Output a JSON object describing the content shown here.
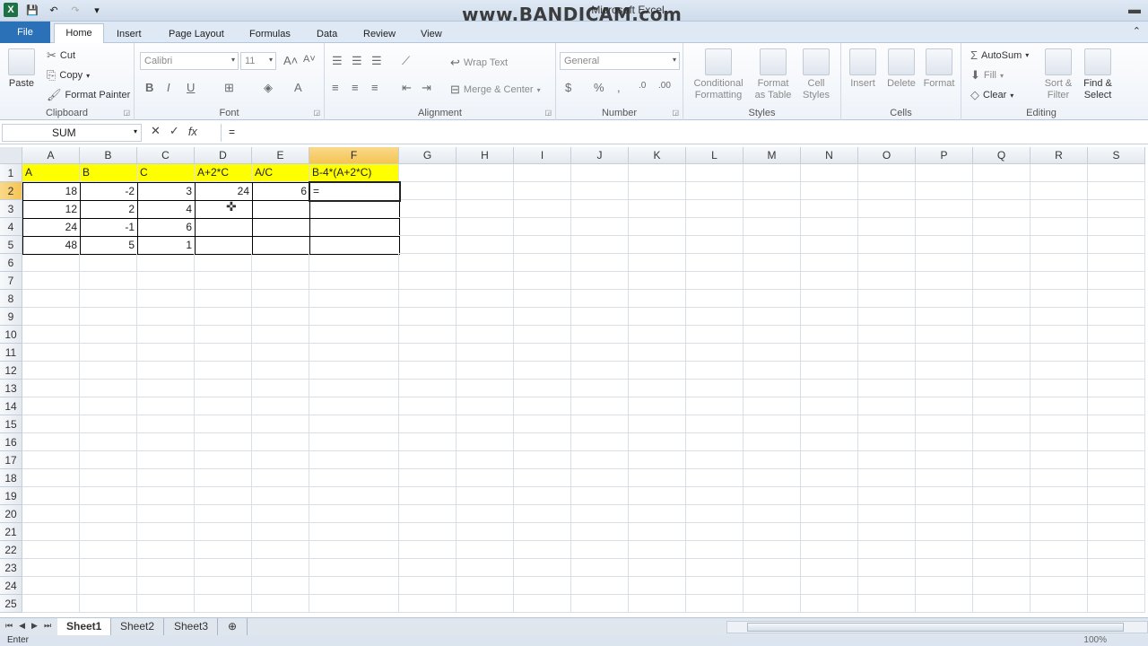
{
  "title_bar": {
    "window_title": "Microsoft Excel",
    "watermark": "www.BANDICAM.com"
  },
  "tabs": [
    "File",
    "Home",
    "Insert",
    "Page Layout",
    "Formulas",
    "Data",
    "Review",
    "View"
  ],
  "clipboard": {
    "paste": "Paste",
    "cut": "Cut",
    "copy": "Copy",
    "format_painter": "Format Painter",
    "label": "Clipboard"
  },
  "font": {
    "name": "Calibri",
    "size": "11",
    "label": "Font"
  },
  "alignment": {
    "wrap_text": "Wrap Text",
    "merge_center": "Merge & Center",
    "label": "Alignment"
  },
  "number": {
    "format": "General",
    "label": "Number"
  },
  "styles": {
    "conditional": "Conditional",
    "formatting": "Formatting",
    "format_as": "Format",
    "as_table": "as Table",
    "cell": "Cell",
    "styles_word": "Styles",
    "label": "Styles"
  },
  "cells": {
    "insert": "Insert",
    "delete": "Delete",
    "format": "Format",
    "label": "Cells"
  },
  "editing": {
    "autosum": "AutoSum",
    "fill": "Fill",
    "clear": "Clear",
    "sort": "Sort &",
    "filter": "Filter",
    "find": "Find &",
    "select": "Select",
    "label": "Editing"
  },
  "formula_bar": {
    "name_box": "SUM",
    "formula": "="
  },
  "columns": [
    "A",
    "B",
    "C",
    "D",
    "E",
    "F",
    "G",
    "H",
    "I",
    "J",
    "K",
    "L",
    "M",
    "N",
    "O",
    "P",
    "Q",
    "R",
    "S"
  ],
  "rows": [
    "1",
    "2",
    "3",
    "4",
    "5",
    "6",
    "7",
    "8",
    "9",
    "10",
    "11",
    "12",
    "13",
    "14",
    "15",
    "16",
    "17",
    "18",
    "19",
    "20",
    "21",
    "22",
    "23",
    "24",
    "25"
  ],
  "table": {
    "headers": [
      "A",
      "B",
      "C",
      "A+2*C",
      "A/C",
      "B-4*(A+2*C)"
    ],
    "rows": [
      [
        "18",
        "-2",
        "3",
        "24",
        "6",
        "="
      ],
      [
        "12",
        "2",
        "4",
        "",
        "",
        ""
      ],
      [
        "24",
        "-1",
        "6",
        "",
        "",
        ""
      ],
      [
        "48",
        "5",
        "1",
        "",
        "",
        ""
      ]
    ]
  },
  "sheets": [
    "Sheet1",
    "Sheet2",
    "Sheet3"
  ],
  "status": {
    "mode": "Enter",
    "zoom": "100%"
  },
  "colors": {
    "header_fill": "#ffff00",
    "active_header": "#f5c453",
    "file_tab": "#2a71b8"
  }
}
